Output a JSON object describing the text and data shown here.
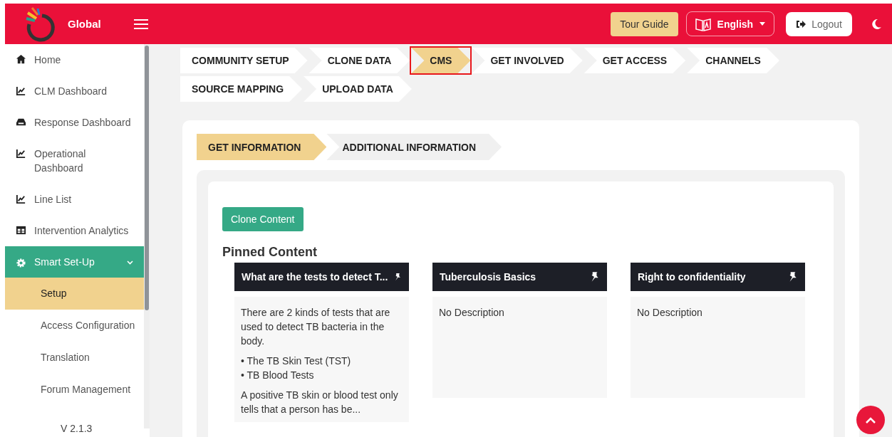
{
  "header": {
    "brand": "Global",
    "buttons": {
      "tour_guide": "Tour Guide",
      "language": "English",
      "logout": "Logout"
    }
  },
  "sidebar": {
    "items": [
      {
        "label": "Home",
        "selected": false
      },
      {
        "label": "CLM Dashboard",
        "selected": false
      },
      {
        "label": "Response Dashboard",
        "selected": false
      },
      {
        "label": "Operational Dashboard",
        "selected": false
      },
      {
        "label": "Line List",
        "selected": false
      },
      {
        "label": "Intervention Analytics",
        "selected": false
      },
      {
        "label": "Smart Set-Up",
        "selected": true,
        "expanded": true,
        "children": [
          {
            "label": "Setup",
            "selected": true
          },
          {
            "label": "Access Configuration",
            "selected": false
          },
          {
            "label": "Translation",
            "selected": false
          },
          {
            "label": "Forum Management",
            "selected": false
          }
        ]
      }
    ],
    "version": "V 2.1.3"
  },
  "steps": [
    {
      "label": "COMMUNITY SETUP",
      "selected": false,
      "annotated": false
    },
    {
      "label": "CLONE DATA",
      "selected": false,
      "annotated": false
    },
    {
      "label": "CMS",
      "selected": true,
      "annotated": true
    },
    {
      "label": "GET INVOLVED",
      "selected": false,
      "annotated": false
    },
    {
      "label": "GET ACCESS",
      "selected": false,
      "annotated": false
    },
    {
      "label": "CHANNELS",
      "selected": false,
      "annotated": false
    },
    {
      "label": "SOURCE MAPPING",
      "selected": false,
      "annotated": false
    },
    {
      "label": "UPLOAD DATA",
      "selected": false,
      "annotated": false
    }
  ],
  "sub_steps": [
    {
      "label": "GET INFORMATION",
      "selected": true
    },
    {
      "label": "ADDITIONAL INFORMATION",
      "selected": false
    }
  ],
  "clone_button": "Clone Content",
  "pinned_title": "Pinned Content",
  "cards": [
    {
      "title": "What are the tests to detect T...",
      "paragraphs": [
        {
          "kind": "text",
          "text": "There are 2 kinds of tests that are used to detect TB bacteria in the body."
        },
        {
          "kind": "bullets",
          "items": [
            "• The TB Skin Test (TST)",
            "• TB Blood Tests"
          ]
        },
        {
          "kind": "text",
          "text": "A positive TB skin or blood test only tells that a person has be..."
        }
      ]
    },
    {
      "title": "Tuberculosis Basics",
      "paragraphs": [
        {
          "kind": "text",
          "text": "No Description"
        }
      ]
    },
    {
      "title": "Right to confidentiality",
      "paragraphs": [
        {
          "kind": "text",
          "text": "No Description"
        }
      ]
    }
  ]
}
